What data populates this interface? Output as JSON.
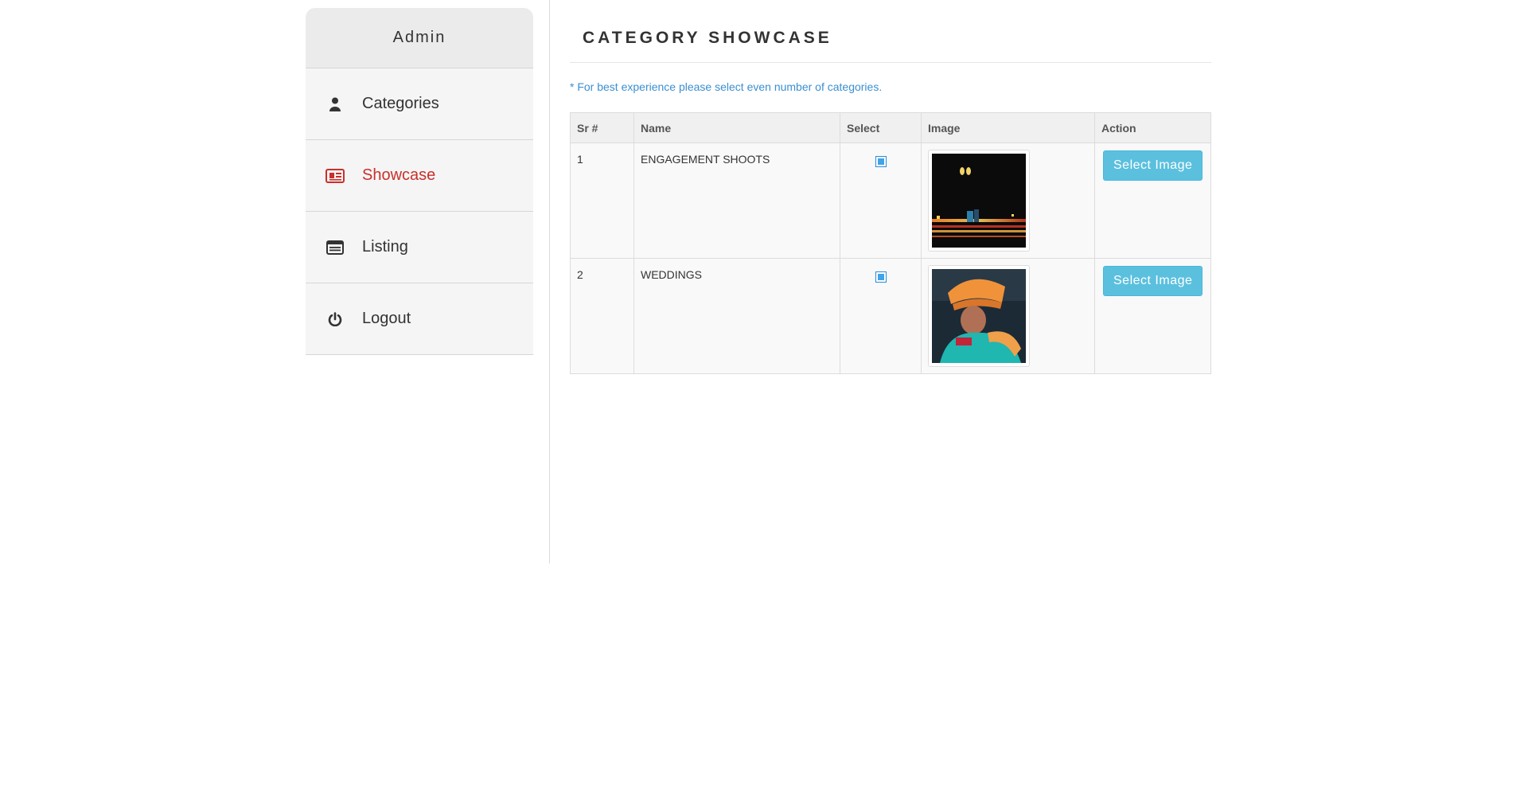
{
  "sidebar": {
    "title": "Admin",
    "items": [
      {
        "label": "Categories",
        "icon": "user-icon",
        "active": false
      },
      {
        "label": "Showcase",
        "icon": "newspaper-icon",
        "active": true
      },
      {
        "label": "Listing",
        "icon": "list-icon",
        "active": false
      },
      {
        "label": "Logout",
        "icon": "power-icon",
        "active": false
      }
    ]
  },
  "main": {
    "title": "CATEGORY SHOWCASE",
    "note": "* For best experience please select even number of categories.",
    "table": {
      "columns": [
        "Sr #",
        "Name",
        "Select",
        "Image",
        "Action"
      ],
      "rows": [
        {
          "sr": "1",
          "name": "ENGAGEMENT SHOOTS",
          "selected": true,
          "action": "Select Image"
        },
        {
          "sr": "2",
          "name": "WEDDINGS",
          "selected": true,
          "action": "Select Image"
        }
      ]
    }
  },
  "colors": {
    "accent_active": "#c9302c",
    "button": "#5bc0de",
    "note": "#3a8fd1"
  }
}
